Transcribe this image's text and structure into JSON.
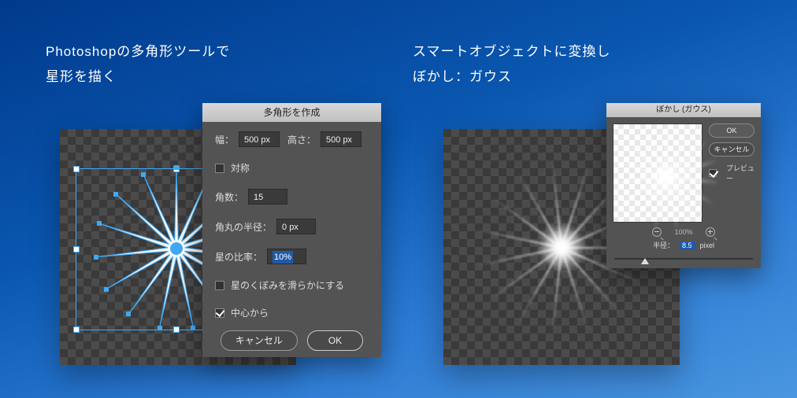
{
  "captions": {
    "left_l1": "Photoshopの多角形ツールで",
    "left_l2": "星形を描く",
    "right_l1": "スマートオブジェクトに変換し",
    "right_l2": "ぼかし：ガウス"
  },
  "poly_dialog": {
    "title": "多角形を作成",
    "width_label": "幅：",
    "width_value": "500 px",
    "height_label": "高さ：",
    "height_value": "500 px",
    "symmetry_label": "対称",
    "symmetry_checked": false,
    "sides_label": "角数：",
    "sides_value": "15",
    "corner_radius_label": "角丸の半径：",
    "corner_radius_value": "0 px",
    "star_ratio_label": "星の比率：",
    "star_ratio_value": "10%",
    "smooth_label": "星のくぼみを滑らかにする",
    "smooth_checked": false,
    "from_center_label": "中心から",
    "from_center_checked": true,
    "cancel": "キャンセル",
    "ok": "OK"
  },
  "gauss_dialog": {
    "title": "ぼかし (ガウス)",
    "ok": "OK",
    "cancel": "キャンセル",
    "preview_label": "プレビュー",
    "preview_checked": true,
    "zoom": "100%",
    "radius_label": "半径：",
    "radius_value": "8.5",
    "radius_unit": "pixel",
    "slider_pos_pct": 22
  },
  "star": {
    "rays": 15
  }
}
